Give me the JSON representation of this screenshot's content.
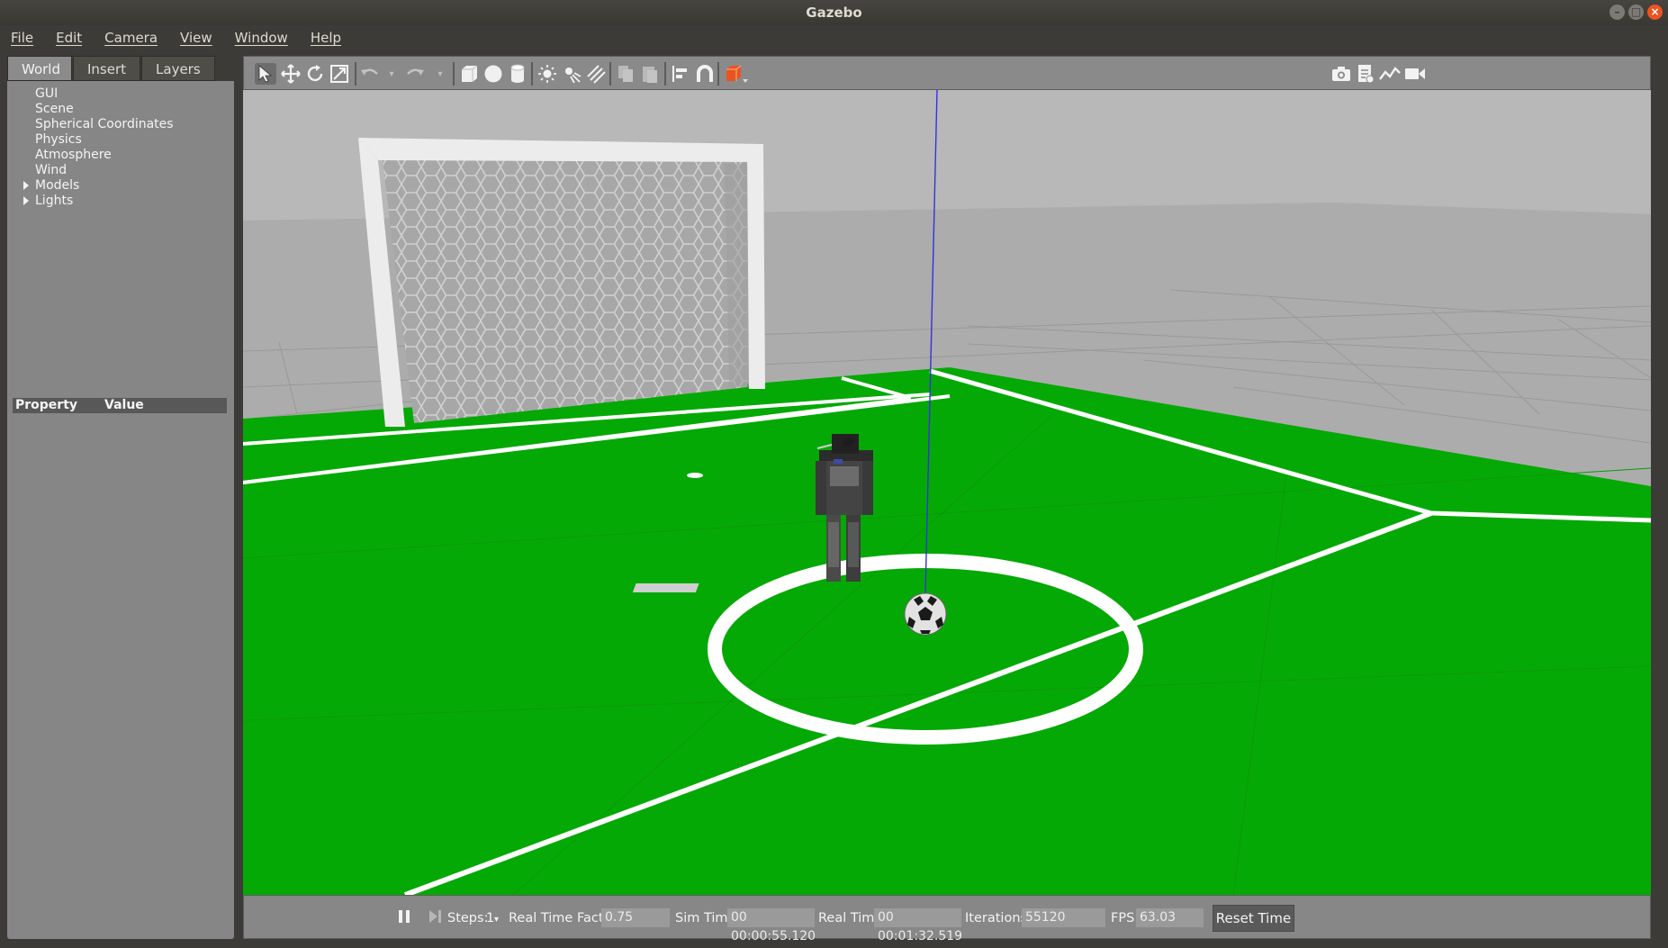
{
  "window": {
    "title": "Gazebo"
  },
  "menu": [
    "File",
    "Edit",
    "Camera",
    "View",
    "Window",
    "Help"
  ],
  "tabs": [
    "World",
    "Insert",
    "Layers"
  ],
  "tree": [
    {
      "label": "GUI",
      "expandable": false
    },
    {
      "label": "Scene",
      "expandable": false
    },
    {
      "label": "Spherical Coordinates",
      "expandable": false
    },
    {
      "label": "Physics",
      "expandable": false
    },
    {
      "label": "Atmosphere",
      "expandable": false
    },
    {
      "label": "Wind",
      "expandable": false
    },
    {
      "label": "Models",
      "expandable": true
    },
    {
      "label": "Lights",
      "expandable": true
    }
  ],
  "properties": {
    "col_property": "Property",
    "col_value": "Value"
  },
  "toolbar": {
    "icons": [
      "select-arrow-icon",
      "translate-icon",
      "rotate-icon",
      "scale-icon",
      "undo-icon",
      "undo-dropdown-icon",
      "redo-icon",
      "redo-dropdown-icon",
      "box-shape-icon",
      "sphere-shape-icon",
      "cylinder-shape-icon",
      "point-light-icon",
      "spot-light-icon",
      "directional-light-icon",
      "copy-icon",
      "paste-icon",
      "align-icon",
      "snap-magnet-icon",
      "view-angle-icon",
      "screenshot-icon",
      "log-icon",
      "plot-icon",
      "record-video-icon"
    ]
  },
  "timebar": {
    "steps_label": "Steps:",
    "steps_value": "1",
    "rtf_label": "Real Time Factor:",
    "rtf_value": "0.75",
    "sim_label": "Sim Time:",
    "sim_value": "00 00:00:55.120",
    "real_label": "Real Time:",
    "real_value": "00 00:01:32.519",
    "iter_label": "Iterations:",
    "iter_value": "55120",
    "fps_label": "FPS:",
    "fps_value": "63.03",
    "reset_label": "Reset Time"
  },
  "colors": {
    "field_green": "#05a905",
    "line_white": "#ffffff",
    "ground_gray": "#b4b4b4",
    "accent_orange": "#e95420"
  }
}
